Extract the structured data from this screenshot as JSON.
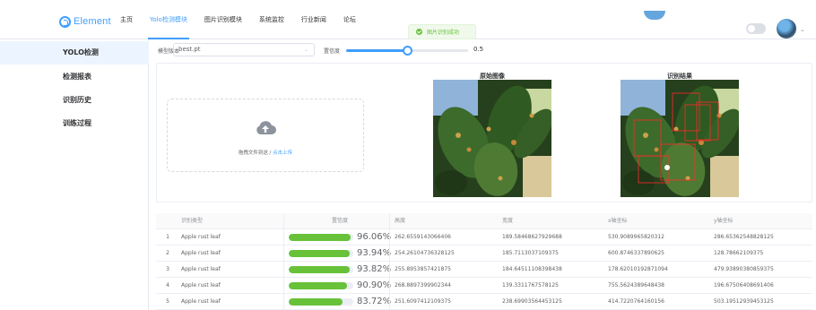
{
  "header": {
    "logo_text": "Element",
    "nav": [
      "主页",
      "Yolo检测模块",
      "图片识别模块",
      "系统监控",
      "行业新闻",
      "论坛"
    ],
    "active_nav_index": 1,
    "toast": "图片识别成功"
  },
  "sidebar": {
    "items": [
      {
        "label": "YOLO检测",
        "active": true
      },
      {
        "label": "检测报表",
        "active": false
      },
      {
        "label": "识别历史",
        "active": false
      },
      {
        "label": "训练过程",
        "active": false
      }
    ]
  },
  "controls": {
    "model_label": "模型版本",
    "model_value": "best.pt",
    "confidence_label": "置信度",
    "confidence_value": "0.5",
    "confidence_fraction": 0.5
  },
  "upload": {
    "text": "拖拽文件到这 / ",
    "link": "点击上传"
  },
  "images": {
    "original_title": "原始图像",
    "result_title": "识别结果"
  },
  "table": {
    "columns": [
      "识别类型",
      "置信度",
      "高度",
      "宽度",
      "x轴坐标",
      "y轴坐标"
    ],
    "rows": [
      {
        "idx": "1",
        "cls": "Apple rust leaf",
        "conf": 0.9606,
        "conf_text": "96.06%",
        "h": "262.6559143066406",
        "w": "189.58468627929688",
        "x": "530.9089965820312",
        "y": "286.65362548828125"
      },
      {
        "idx": "2",
        "cls": "Apple rust leaf",
        "conf": 0.9394,
        "conf_text": "93.94%",
        "h": "254.26104736328125",
        "w": "185.7113037109375",
        "x": "600.8746337890625",
        "y": "128.78662109375"
      },
      {
        "idx": "3",
        "cls": "Apple rust leaf",
        "conf": 0.9382,
        "conf_text": "93.82%",
        "h": "255.8953857421875",
        "w": "184.64511108398438",
        "x": "178.62010192871094",
        "y": "479.93890380859375"
      },
      {
        "idx": "4",
        "cls": "Apple rust leaf",
        "conf": 0.909,
        "conf_text": "90.90%",
        "h": "268.8897399902344",
        "w": "139.3311767578125",
        "x": "755.5624389648438",
        "y": "196.67506408691406"
      },
      {
        "idx": "5",
        "cls": "Apple rust leaf",
        "conf": 0.8372,
        "conf_text": "83.72%",
        "h": "251.6097412109375",
        "w": "238.69903564453125",
        "x": "414.7220764160156",
        "y": "503.19512939453125"
      }
    ]
  },
  "colors": {
    "primary": "#409eff",
    "success": "#67c23a"
  }
}
